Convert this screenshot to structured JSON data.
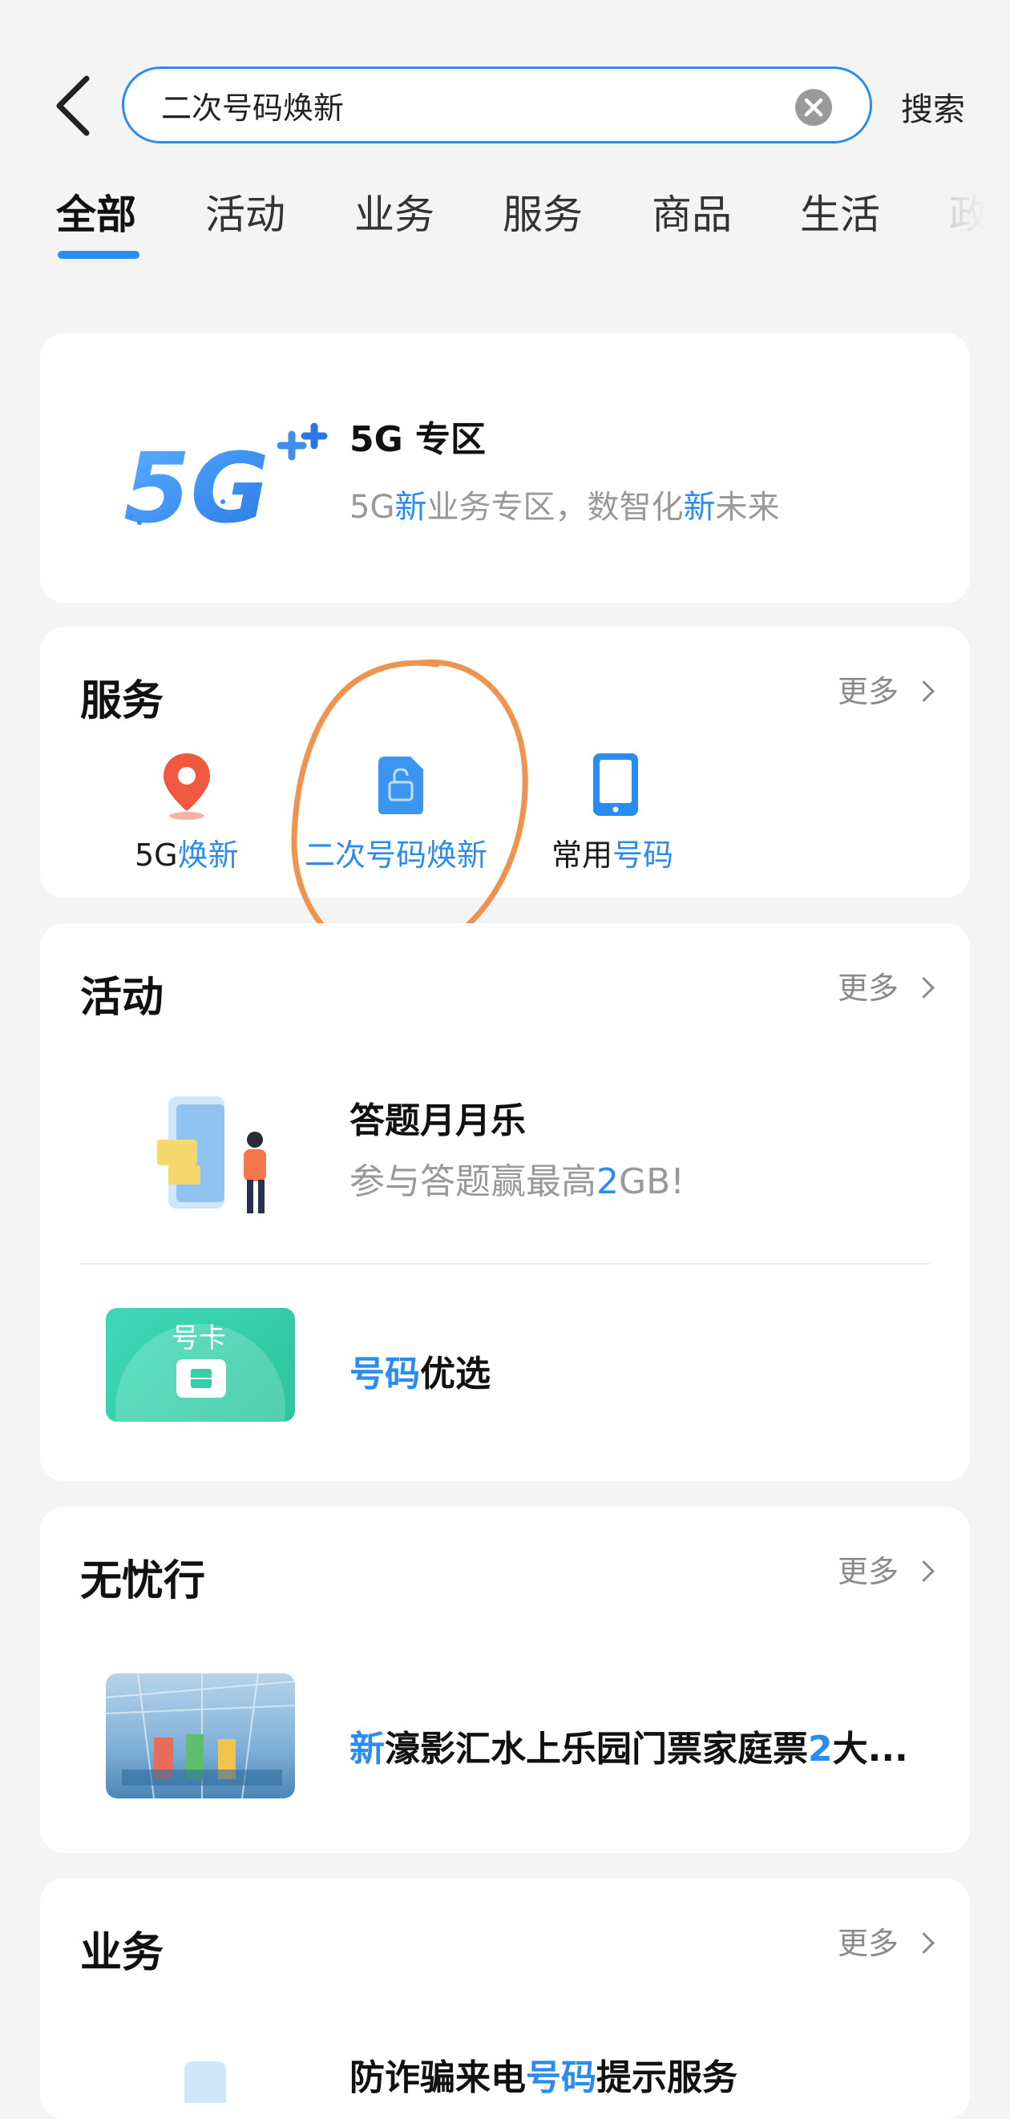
{
  "header": {
    "search_value": "二次号码焕新",
    "search_button": "搜索"
  },
  "tabs": [
    "全部",
    "活动",
    "业务",
    "服务",
    "商品",
    "生活",
    "政"
  ],
  "fiveg": {
    "title": "5G 专区",
    "subtitle_parts": [
      "5G",
      "新",
      "业务专区，数智化",
      "新",
      "未来"
    ]
  },
  "services": {
    "title": "服务",
    "more": "更多",
    "items": [
      {
        "prefix": "5G",
        "highlight": "焕新"
      },
      {
        "prefix": "",
        "highlight": "二次号码焕新"
      },
      {
        "prefix": "常用",
        "highlight": "号码"
      }
    ]
  },
  "activities": {
    "title": "活动",
    "more": "更多",
    "item1": {
      "title": "答题月月乐",
      "sub_a": "参与答题赢最高",
      "sub_b": "2",
      "sub_c": "GB!"
    },
    "item2": {
      "title_a": "号码",
      "title_b": "优选",
      "thumb_label": "号卡"
    }
  },
  "travel": {
    "title": "无忧行",
    "more": "更多",
    "item": {
      "a": "新",
      "b": "濠影汇水上乐园门票家庭票",
      "c": "2",
      "d": "大..."
    }
  },
  "business": {
    "title": "业务",
    "more": "更多",
    "item": {
      "a": "防诈骗来电",
      "b": "号码",
      "c": "提示服务"
    }
  },
  "colors": {
    "accent": "#2a8cf0",
    "annotation": "#ee9450"
  }
}
